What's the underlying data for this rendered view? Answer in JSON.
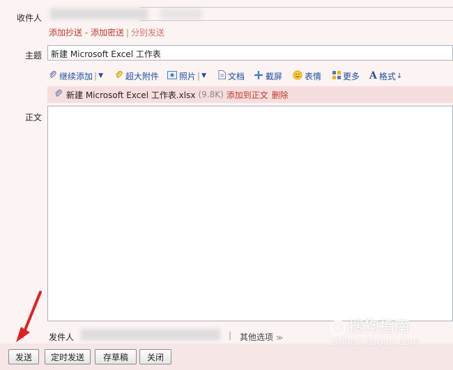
{
  "recipient": {
    "label": "收件人"
  },
  "cc_links": {
    "add_cc": "添加抄送",
    "dash": " - ",
    "add_bcc": "添加密送",
    "pipe": "|",
    "separate": "分别发送"
  },
  "subject": {
    "label": "主题",
    "value": "新建 Microsoft Excel 工作表"
  },
  "toolbar": {
    "continue_add": "继续添加",
    "large_attach": "超大附件",
    "photo": "照片",
    "document": "文档",
    "screenshot": "截屏",
    "emoji": "表情",
    "more": "更多",
    "format": "格式"
  },
  "attachment": {
    "name": "新建 Microsoft Excel 工作表.xlsx",
    "size": "(9.8K)",
    "add_to_body": "添加到正文",
    "delete": "删除"
  },
  "body": {
    "label": "正文"
  },
  "sender": {
    "label": "发件人",
    "other_options": "其他选项"
  },
  "buttons": {
    "send": "发送",
    "timed_send": "定时发送",
    "save_draft": "存草稿",
    "close": "关闭"
  },
  "watermark": {
    "line1": "搜狗指南",
    "line2": "zhinan.sogou.com"
  }
}
